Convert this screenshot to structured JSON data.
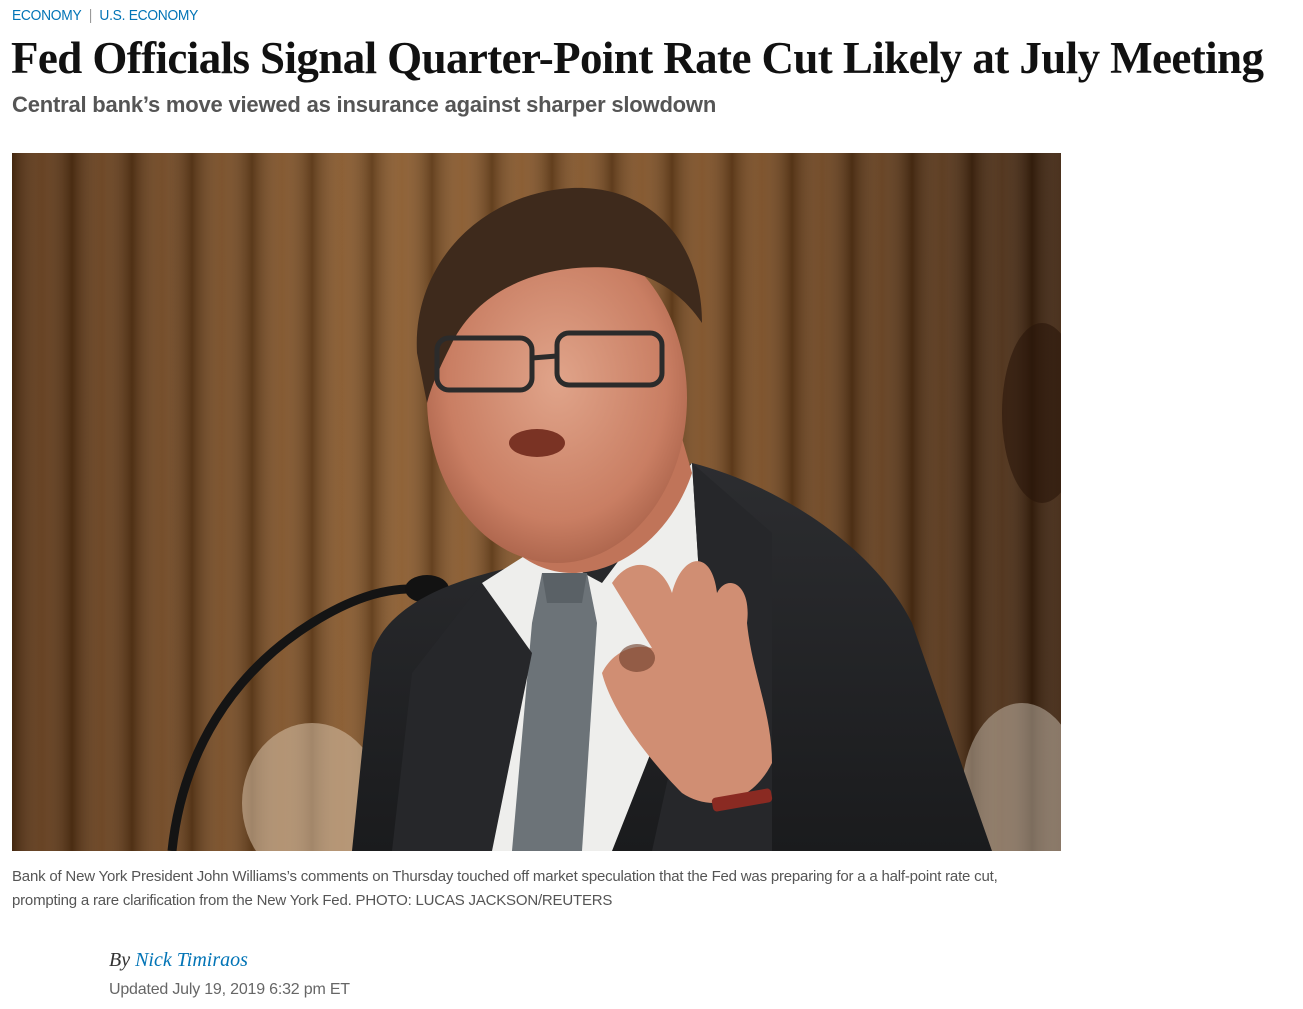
{
  "breadcrumb": {
    "section": "ECONOMY",
    "separator": "|",
    "subsection": "U.S. ECONOMY"
  },
  "article": {
    "headline": "Fed Officials Signal Quarter-Point Rate Cut Likely at July Meeting",
    "dek": "Central bank’s move viewed as insurance against sharper slowdown",
    "caption": "Bank of New York President John Williams’s comments on Thursday touched off market speculation that the Fed was preparing for a a half-point rate cut, prompting a rare clarification from the New York Fed.",
    "photo_credit": "PHOTO: LUCAS JACKSON/REUTERS",
    "byline_prefix": "By",
    "author": "Nick Timiraos",
    "updated": "Updated July 19, 2019 6:32 pm ET"
  },
  "colors": {
    "link": "#0274b6",
    "headline": "#111111",
    "muted": "#555555"
  }
}
